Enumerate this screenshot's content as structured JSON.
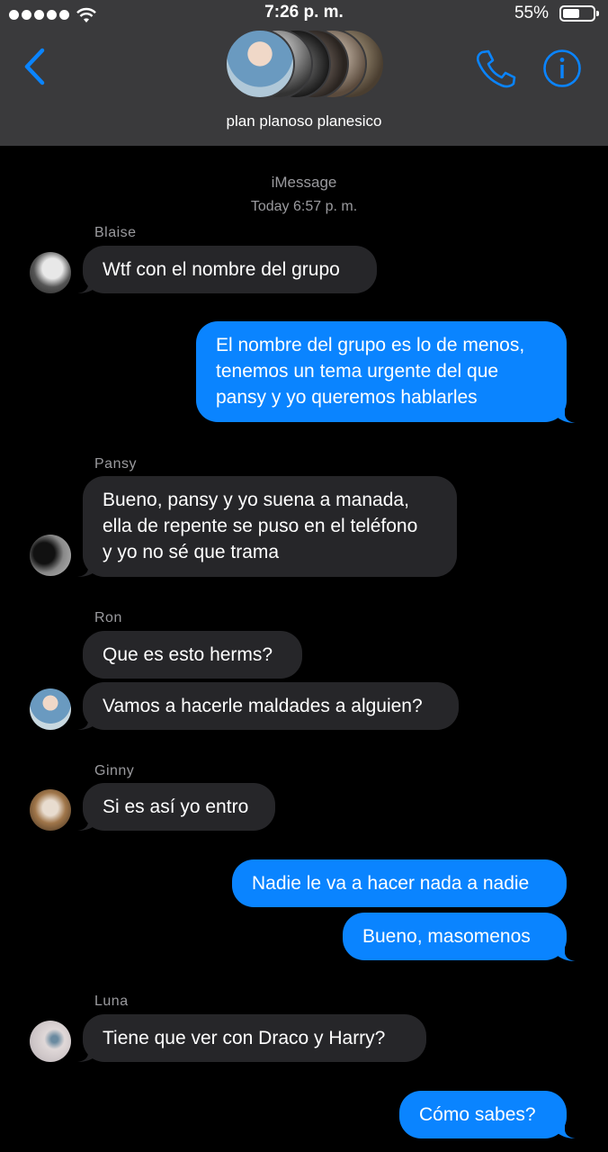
{
  "status_bar": {
    "time": "7:26 p. m.",
    "battery": "55%",
    "battery_level": 0.55
  },
  "header": {
    "group_name": "plan planoso planesico"
  },
  "thread": {
    "service": "iMessage",
    "timestamp": "Today 6:57 p. m."
  },
  "colors": {
    "header_bg": "#3a3a3c",
    "accent": "#0a84ff",
    "incoming": "#262629",
    "background": "#000000"
  },
  "icons": [
    "back-chevron-icon",
    "phone-icon",
    "info-icon",
    "wifi-icon",
    "battery-icon"
  ],
  "messages": [
    {
      "sender": "Blaise",
      "text": "Wtf con el nombre del grupo"
    },
    {
      "sender": "me",
      "text": "El nombre del grupo es lo de menos,\ntenemos un tema urgente del que\npansy y yo queremos hablarles"
    },
    {
      "sender": "Pansy",
      "text": "Bueno, pansy y yo suena a manada,\nella de repente se puso en el teléfono\ny yo no sé que trama"
    },
    {
      "sender": "Ron",
      "text": "Que es esto herms?"
    },
    {
      "sender": "Ron",
      "text": "Vamos a hacerle maldades a alguien?"
    },
    {
      "sender": "Ginny",
      "text": "Si es así yo entro"
    },
    {
      "sender": "me",
      "text": "Nadie le va a hacer nada a nadie"
    },
    {
      "sender": "me",
      "text": "Bueno, masomenos"
    },
    {
      "sender": "Luna",
      "text": "Tiene que ver con Draco y Harry?"
    },
    {
      "sender": "me",
      "text": "Cómo sabes?"
    }
  ]
}
